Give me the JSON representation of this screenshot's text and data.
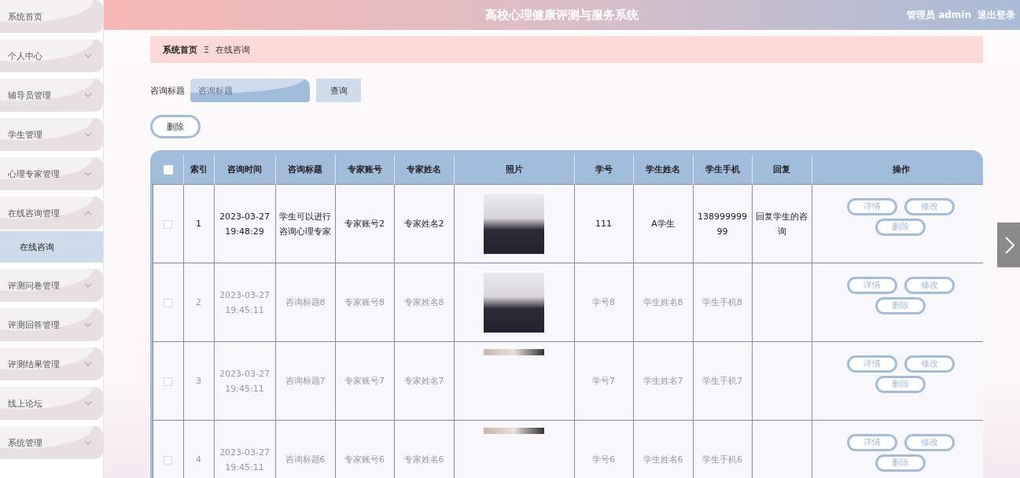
{
  "sidebar": {
    "items": [
      {
        "label": "系统首页",
        "has_arrow": false
      },
      {
        "label": "个人中心",
        "has_arrow": true,
        "expanded": false
      },
      {
        "label": "辅导员管理",
        "has_arrow": true,
        "expanded": false
      },
      {
        "label": "学生管理",
        "has_arrow": true,
        "expanded": false
      },
      {
        "label": "心理专家管理",
        "has_arrow": true,
        "expanded": false
      },
      {
        "label": "在线咨询管理",
        "has_arrow": true,
        "expanded": true,
        "children": [
          {
            "label": "在线咨询",
            "selected": true
          }
        ]
      },
      {
        "label": "评测问卷管理",
        "has_arrow": true,
        "expanded": false
      },
      {
        "label": "评测回答管理",
        "has_arrow": true,
        "expanded": false
      },
      {
        "label": "评测结果管理",
        "has_arrow": true,
        "expanded": false
      },
      {
        "label": "线上论坛",
        "has_arrow": true,
        "expanded": false
      },
      {
        "label": "系统管理",
        "has_arrow": true,
        "expanded": false
      }
    ]
  },
  "header": {
    "title": "高校心理健康评测与服务系统",
    "user": "管理员 admin",
    "logout": "退出登录"
  },
  "breadcrumb": {
    "home": "系统首页",
    "separator": "Ξ",
    "current": "在线咨询"
  },
  "search": {
    "label": "咨询标题",
    "placeholder": "咨询标题",
    "button": "查询"
  },
  "delete_button": "删除",
  "table": {
    "select_all_checked": false,
    "columns": [
      "索引",
      "咨询时间",
      "咨询标题",
      "专家账号",
      "专家姓名",
      "照片",
      "学号",
      "学生姓名",
      "学生手机",
      "回复",
      "操作"
    ],
    "rows": [
      {
        "checked": false,
        "highlighted": true,
        "photo_partial": false,
        "cells": [
          "1",
          "2023-03-27 19:48:29",
          "学生可以进行咨询心理专家",
          "专家账号2",
          "专家姓名2",
          "",
          "111",
          "A学生",
          "13899999999",
          "回复学生的咨询"
        ],
        "actions": [
          "详情",
          "修改",
          "删除"
        ]
      },
      {
        "checked": false,
        "highlighted": false,
        "photo_partial": false,
        "cells": [
          "2",
          "2023-03-27 19:45:11",
          "咨询标题8",
          "专家账号8",
          "专家姓名8",
          "",
          "学号8",
          "学生姓名8",
          "学生手机8",
          ""
        ],
        "actions": [
          "详情",
          "修改",
          "删除"
        ]
      },
      {
        "checked": false,
        "highlighted": false,
        "photo_partial": true,
        "cells": [
          "3",
          "2023-03-27 19:45:11",
          "咨询标题7",
          "专家账号7",
          "专家姓名7",
          "",
          "学号7",
          "学生姓名7",
          "学生手机7",
          ""
        ],
        "actions": [
          "详情",
          "修改",
          "删除"
        ]
      },
      {
        "checked": false,
        "highlighted": false,
        "photo_partial": true,
        "cells": [
          "4",
          "2023-03-27 19:45:11",
          "咨询标题6",
          "专家账号6",
          "专家姓名6",
          "",
          "学号6",
          "学生姓名6",
          "学生手机6",
          ""
        ],
        "actions": [
          "详情",
          "修改",
          "删除"
        ]
      }
    ]
  }
}
